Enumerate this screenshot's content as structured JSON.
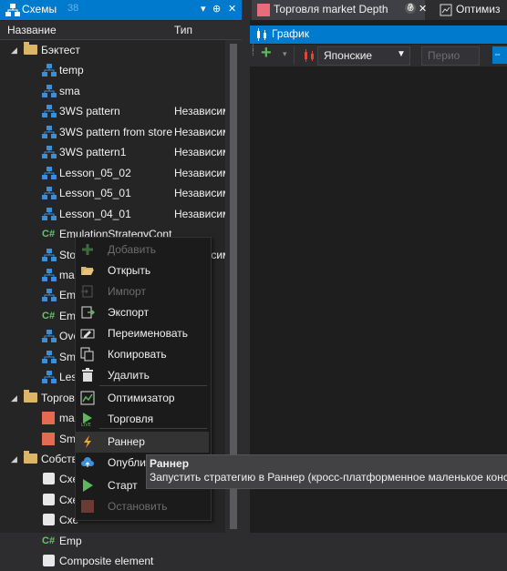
{
  "left_panel": {
    "tab_title": "Схемы",
    "tab_count": "38",
    "columns": {
      "name": "Название",
      "type": "Тип"
    },
    "tree": [
      {
        "label": "Бэктест",
        "kind": "folder",
        "expanded": true
      },
      {
        "label": "temp",
        "kind": "schema",
        "type": ""
      },
      {
        "label": "sma",
        "kind": "schema",
        "type": ""
      },
      {
        "label": "3WS pattern",
        "kind": "schema",
        "type": "Независим"
      },
      {
        "label": "3WS pattern from store",
        "kind": "schema",
        "type": "Независим"
      },
      {
        "label": "3WS pattern1",
        "kind": "schema",
        "type": "Независим"
      },
      {
        "label": "Lesson_05_02",
        "kind": "schema",
        "type": "Независим"
      },
      {
        "label": "Lesson_05_01",
        "kind": "schema",
        "type": "Независим"
      },
      {
        "label": "Lesson_04_01",
        "kind": "schema",
        "type": "Независим"
      },
      {
        "label": "EmulationStrategyCont",
        "kind": "csharp",
        "type": ""
      },
      {
        "label": "Stop",
        "kind": "schema",
        "type": "Независим"
      },
      {
        "label": "ma",
        "kind": "schema",
        "type": ""
      },
      {
        "label": "Emu",
        "kind": "schema",
        "type": ""
      },
      {
        "label": "Emu",
        "kind": "csharp",
        "type": ""
      },
      {
        "label": "Ove",
        "kind": "schema",
        "type": ""
      },
      {
        "label": "Sma",
        "kind": "schema",
        "type": ""
      },
      {
        "label": "Less",
        "kind": "schema",
        "type": ""
      },
      {
        "label": "Торгова",
        "kind": "folder",
        "expanded": true
      },
      {
        "label": "mar",
        "kind": "orange",
        "type": ""
      },
      {
        "label": "Sma",
        "kind": "orange",
        "type": ""
      },
      {
        "label": "Собств",
        "kind": "folder",
        "expanded": true
      },
      {
        "label": "Схе",
        "kind": "puzzle",
        "type": ""
      },
      {
        "label": "Схе",
        "kind": "puzzle",
        "type": ""
      },
      {
        "label": "Схе",
        "kind": "puzzle",
        "type": ""
      },
      {
        "label": "Emp",
        "kind": "csharp",
        "type": ""
      },
      {
        "label": "Composite element",
        "kind": "puzzle",
        "type": ""
      }
    ]
  },
  "right_panel": {
    "tabs": [
      {
        "label": "Торговля market Depth",
        "help": "?",
        "pin": "⊕",
        "close": "✕"
      },
      {
        "label": "Оптимиз"
      }
    ],
    "chart_header": "График",
    "toolbar": {
      "add": "+",
      "style_select": "Японские",
      "period_select": "Перио"
    }
  },
  "context_menu": [
    {
      "label": "Добавить",
      "icon": "plus-icon",
      "enabled": false
    },
    {
      "label": "Открыть",
      "icon": "folder-open-icon",
      "enabled": true
    },
    {
      "label": "Импорт",
      "icon": "import-icon",
      "enabled": false
    },
    {
      "label": "Экспорт",
      "icon": "export-icon",
      "enabled": true
    },
    {
      "label": "Переименовать",
      "icon": "rename-icon",
      "enabled": true
    },
    {
      "label": "Копировать",
      "icon": "copy-icon",
      "enabled": true
    },
    {
      "label": "Удалить",
      "icon": "trash-icon",
      "enabled": true
    },
    {
      "label": "Оптимизатор",
      "icon": "optimizer-icon",
      "enabled": true
    },
    {
      "label": "Торговля",
      "icon": "live-trading-icon",
      "enabled": true
    },
    {
      "label": "Раннер",
      "icon": "runner-icon",
      "enabled": true,
      "highlighted": true
    },
    {
      "label": "Опубли",
      "icon": "cloud-upload-icon",
      "enabled": true
    },
    {
      "label": "Старт",
      "icon": "play-icon",
      "enabled": true
    },
    {
      "label": "Остановить",
      "icon": "stop-icon",
      "enabled": false
    }
  ],
  "tooltip": {
    "title": "Раннер",
    "text": "Запустить стратегию в Раннер (кросс-платформенное маленькое консо"
  },
  "colors": {
    "accent": "#007acc",
    "folder": "#dcb567",
    "csharp": "#68c56e",
    "orange": "#e46b4f"
  }
}
